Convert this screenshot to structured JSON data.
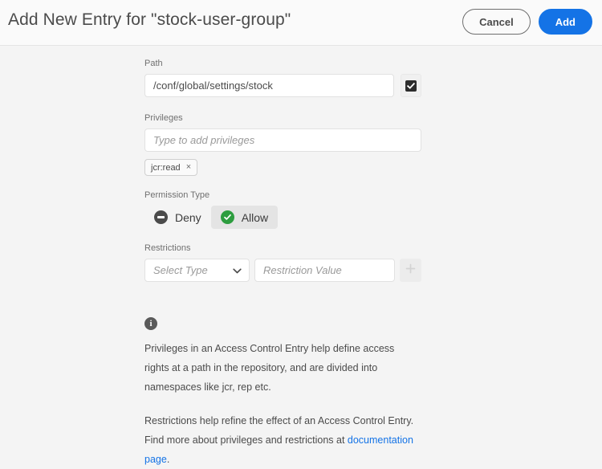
{
  "header": {
    "title": "Add New Entry for \"stock-user-group\"",
    "cancel_label": "Cancel",
    "add_label": "Add",
    "accent_color": "#1473e6"
  },
  "form": {
    "path": {
      "label": "Path",
      "value": "/conf/global/settings/stock",
      "checkbox_checked": true,
      "checkbox_icon": "checkmark-icon"
    },
    "privileges": {
      "label": "Privileges",
      "placeholder": "Type to add privileges",
      "value": "",
      "tags": [
        {
          "label": "jcr:read",
          "remove_icon": "close-icon",
          "remove_label": "×"
        }
      ]
    },
    "permission_type": {
      "label": "Permission Type",
      "options": [
        {
          "label": "Deny",
          "icon": "deny-circle-icon",
          "selected": false
        },
        {
          "label": "Allow",
          "icon": "check-circle-icon",
          "selected": true
        }
      ],
      "selected": "Allow",
      "deny_color": "#4b4b4b",
      "allow_color": "#2d9d3f"
    },
    "restrictions": {
      "label": "Restrictions",
      "type_placeholder": "Select Type",
      "type_value": "",
      "value_placeholder": "Restriction Value",
      "value": "",
      "add_label": "+",
      "add_disabled": true,
      "chevron_icon": "chevron-down-icon"
    }
  },
  "info": {
    "icon": "info-icon",
    "icon_glyph": "i",
    "paragraph_1": "Privileges in an Access Control Entry help define access rights at a path in the repository, and are divided into namespaces like jcr, rep etc.",
    "paragraph_2_before": "Restrictions help refine the effect of an Access Control Entry. Find more about privileges and restrictions at ",
    "link_text": "documentation page",
    "paragraph_2_after": ".",
    "link_color": "#1473e6"
  }
}
